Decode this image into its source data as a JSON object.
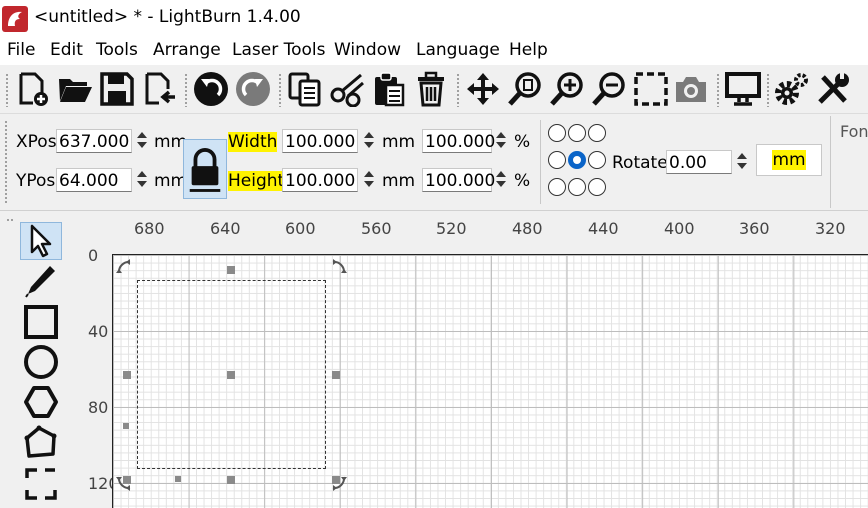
{
  "window": {
    "title": "<untitled> * - LightBurn 1.4.00"
  },
  "menu": {
    "items": [
      "File",
      "Edit",
      "Tools",
      "Arrange",
      "Laser Tools",
      "Window",
      "Language",
      "Help"
    ]
  },
  "toolbar": {
    "icons": [
      "new-file-icon",
      "open-folder-icon",
      "save-icon",
      "import-icon",
      "undo-icon",
      "redo-icon",
      "copy-icon",
      "cut-icon",
      "paste-icon",
      "delete-icon",
      "move-icon",
      "zoom-page-icon",
      "zoom-in-icon",
      "zoom-out-icon",
      "zoom-selection-icon",
      "camera-icon",
      "monitor-icon",
      "settings-icon",
      "tools-icon"
    ]
  },
  "numeric": {
    "xpos_label": "XPos",
    "xpos_value": "637.000",
    "ypos_label": "YPos",
    "ypos_value": "64.000",
    "unit": "mm",
    "width_label": "Width",
    "width_value": "100.000",
    "height_label": "Height",
    "height_value": "100.000",
    "width_pct": "100.000",
    "height_pct": "100.000",
    "pct_symbol": "%",
    "rotate_label": "Rotate",
    "rotate_value": "0.00",
    "unit_button": "mm",
    "font_label": "Fon",
    "highlight_color": "#fff300"
  },
  "ruler": {
    "top_labels": [
      "680",
      "640",
      "600",
      "560",
      "520",
      "480",
      "440",
      "400",
      "360",
      "320"
    ],
    "left_labels": [
      "0",
      "40",
      "80",
      "120"
    ]
  }
}
